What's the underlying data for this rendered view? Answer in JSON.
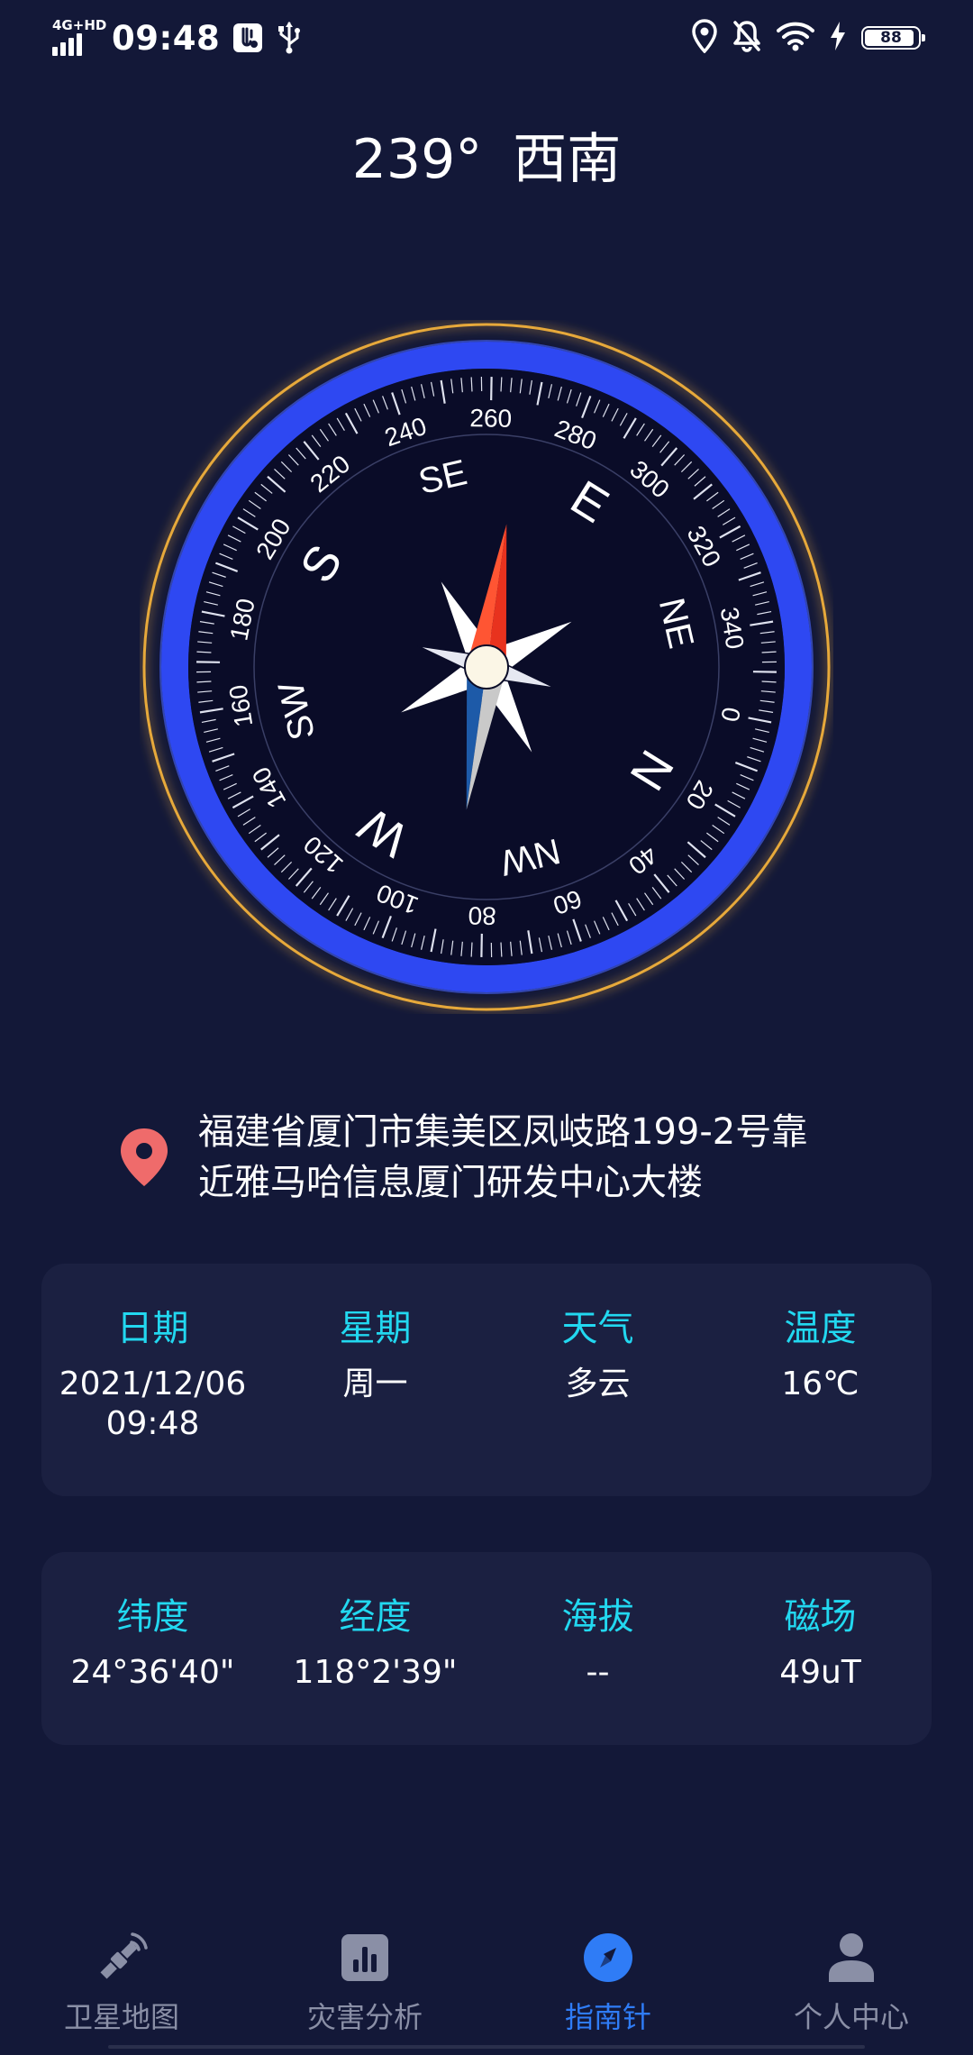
{
  "status_bar": {
    "network": "4G+HD",
    "time": "09:48",
    "battery": "88",
    "battery_fraction": 0.88
  },
  "heading": {
    "degrees": "239°",
    "direction": "西南"
  },
  "compass": {
    "heading_degrees": 239,
    "dial_labels": [
      "0",
      "20",
      "40",
      "60",
      "80",
      "100",
      "120",
      "140",
      "160",
      "180",
      "200",
      "220",
      "240",
      "260",
      "280",
      "300",
      "320",
      "340"
    ],
    "cardinal_labels": [
      "N",
      "NE",
      "E",
      "SE",
      "S",
      "SW",
      "W",
      "NW"
    ],
    "colors": {
      "outer_ring": "#e7a93a",
      "blue_ring": "#2e48f2",
      "dial_face": "#0a0c28",
      "needle_north": "#e8321e",
      "needle_south": "#1d5aa8"
    }
  },
  "location": {
    "icon": "location-pin-icon",
    "address_line1": "福建省厦门市集美区凤岐路199-2号靠",
    "address_line2": "近雅马哈信息厦门研发中心大楼"
  },
  "info_card_1": {
    "items": [
      {
        "label": "日期",
        "value_lines": [
          "2021/12/06",
          "09:48"
        ]
      },
      {
        "label": "星期",
        "value_lines": [
          "周一"
        ]
      },
      {
        "label": "天气",
        "value_lines": [
          "多云"
        ]
      },
      {
        "label": "温度",
        "value_lines": [
          "16℃"
        ]
      }
    ]
  },
  "info_card_2": {
    "items": [
      {
        "label": "纬度",
        "value": "24°36'40\""
      },
      {
        "label": "经度",
        "value": "118°2'39\""
      },
      {
        "label": "海拔",
        "value": "--"
      },
      {
        "label": "磁场",
        "value": "49uT"
      }
    ]
  },
  "bottom_nav": {
    "items": [
      {
        "label": "卫星地图",
        "icon": "satellite-icon",
        "active": false
      },
      {
        "label": "灾害分析",
        "icon": "bar-chart-icon",
        "active": false
      },
      {
        "label": "指南针",
        "icon": "compass-icon",
        "active": true
      },
      {
        "label": "个人中心",
        "icon": "person-icon",
        "active": false
      }
    ]
  },
  "colors": {
    "background": "#131838",
    "card": "#1b2041",
    "accent_cyan": "#22d8f0",
    "active_blue": "#2f7cf6",
    "inactive_gray": "#8a8fa6"
  }
}
